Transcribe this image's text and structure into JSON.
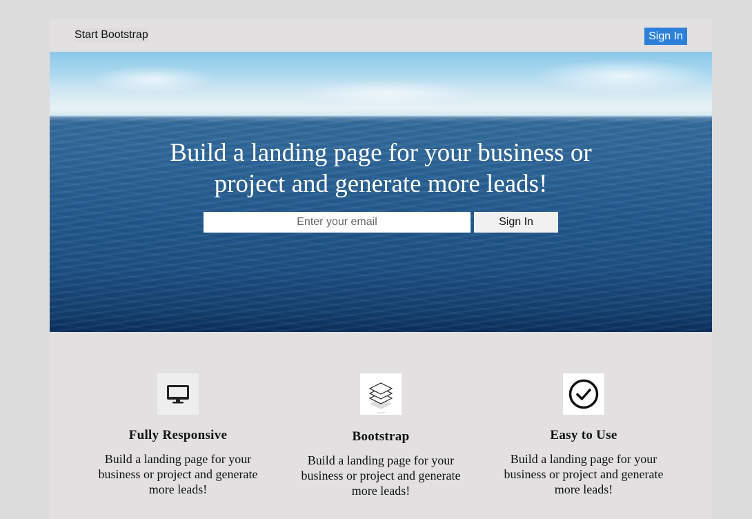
{
  "navbar": {
    "brand": "Start Bootstrap",
    "signin_label": "Sign In",
    "signin_color": "#2d80d8"
  },
  "hero": {
    "headline_line1": "Build a landing page for your business or",
    "headline_line2": "project and generate more leads!",
    "email_placeholder": "Enter your email",
    "signin_label": "Sign In"
  },
  "features": [
    {
      "icon": "monitor-icon",
      "title": "Fully Responsive",
      "text_line1": "Build a landing page for your",
      "text_line2": "business or project and generate",
      "text_line3": "more leads!"
    },
    {
      "icon": "layers-icon",
      "title": "Bootstrap",
      "text_line1": "Build a landing page for your",
      "text_line2": "business or project and generate",
      "text_line3": "more leads!"
    },
    {
      "icon": "check-circle-icon",
      "title": "Easy to Use",
      "text_line1": "Build a landing page for your",
      "text_line2": "business or project and generate",
      "text_line3": "more leads!"
    }
  ]
}
